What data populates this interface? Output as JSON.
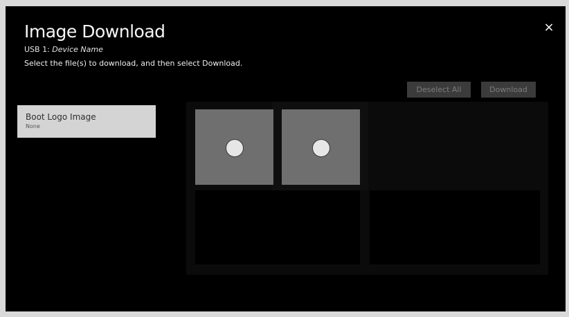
{
  "header": {
    "title": "Image Download",
    "device_prefix": "USB 1: ",
    "device_name": "Device Name",
    "instruction": "Select the file(s) to download, and then select Download.",
    "close_icon": "×"
  },
  "actions": {
    "deselect_all_label": "Deselect All",
    "download_label": "Download"
  },
  "categories": [
    {
      "label": "Boot Logo Image",
      "value": "None"
    }
  ],
  "thumbnails": [
    {
      "selected": false
    },
    {
      "selected": false
    }
  ],
  "colors": {
    "background": "#000000",
    "thumbnail": "#6f6f6f",
    "category_bg": "#d4d4d4",
    "disabled_button_bg": "#3b3b3b",
    "disabled_button_text": "#7c7c7c"
  }
}
